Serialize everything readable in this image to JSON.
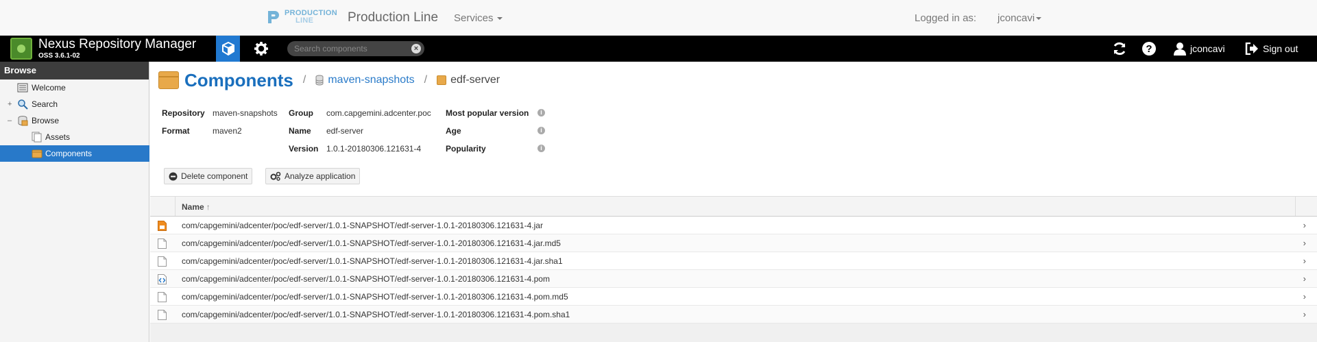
{
  "production_line": {
    "logo_line1": "PRODUCTION",
    "logo_line2": "LINE",
    "title": "Production Line",
    "services_label": "Services",
    "logged_in_label": "Logged in as:",
    "username": "jconcavi"
  },
  "header": {
    "app_title": "Nexus Repository Manager",
    "version": "OSS 3.6.1-02",
    "search_placeholder": "Search components",
    "user": "jconcavi",
    "signout_label": "Sign out"
  },
  "sidebar": {
    "heading": "Browse",
    "items": [
      {
        "label": "Welcome",
        "icon": "welcome-icon",
        "expander": ""
      },
      {
        "label": "Search",
        "icon": "search-icon",
        "expander": "+"
      },
      {
        "label": "Browse",
        "icon": "browse-icon",
        "expander": "–"
      },
      {
        "label": "Assets",
        "icon": "assets-icon",
        "expander": ""
      },
      {
        "label": "Components",
        "icon": "components-icon",
        "expander": ""
      }
    ],
    "selected_index": 4
  },
  "breadcrumb": {
    "title": "Components",
    "sep1": "/",
    "repository": "maven-snapshots",
    "sep2": "/",
    "component": "edf-server"
  },
  "details": {
    "repository_label": "Repository",
    "repository_value": "maven-snapshots",
    "format_label": "Format",
    "format_value": "maven2",
    "group_label": "Group",
    "group_value": "com.capgemini.adcenter.poc",
    "name_label": "Name",
    "name_value": "edf-server",
    "version_label": "Version",
    "version_value": "1.0.1-20180306.121631-4",
    "popular_label": "Most popular version",
    "age_label": "Age",
    "popularity_label": "Popularity"
  },
  "actions": {
    "delete_label": "Delete component",
    "analyze_label": "Analyze application"
  },
  "grid": {
    "column_name": "Name",
    "sort_indicator": "↑",
    "rows": [
      {
        "name": "com/capgemini/adcenter/poc/edf-server/1.0.1-SNAPSHOT/edf-server-1.0.1-20180306.121631-4.jar",
        "icon": "jar-file-icon"
      },
      {
        "name": "com/capgemini/adcenter/poc/edf-server/1.0.1-SNAPSHOT/edf-server-1.0.1-20180306.121631-4.jar.md5",
        "icon": "file-icon"
      },
      {
        "name": "com/capgemini/adcenter/poc/edf-server/1.0.1-SNAPSHOT/edf-server-1.0.1-20180306.121631-4.jar.sha1",
        "icon": "file-icon"
      },
      {
        "name": "com/capgemini/adcenter/poc/edf-server/1.0.1-SNAPSHOT/edf-server-1.0.1-20180306.121631-4.pom",
        "icon": "pom-file-icon"
      },
      {
        "name": "com/capgemini/adcenter/poc/edf-server/1.0.1-SNAPSHOT/edf-server-1.0.1-20180306.121631-4.pom.md5",
        "icon": "file-icon"
      },
      {
        "name": "com/capgemini/adcenter/poc/edf-server/1.0.1-SNAPSHOT/edf-server-1.0.1-20180306.121631-4.pom.sha1",
        "icon": "file-icon"
      }
    ]
  },
  "colors": {
    "accent": "#2879c9",
    "header_bg": "#000000",
    "title_blue": "#1a6fbd"
  }
}
